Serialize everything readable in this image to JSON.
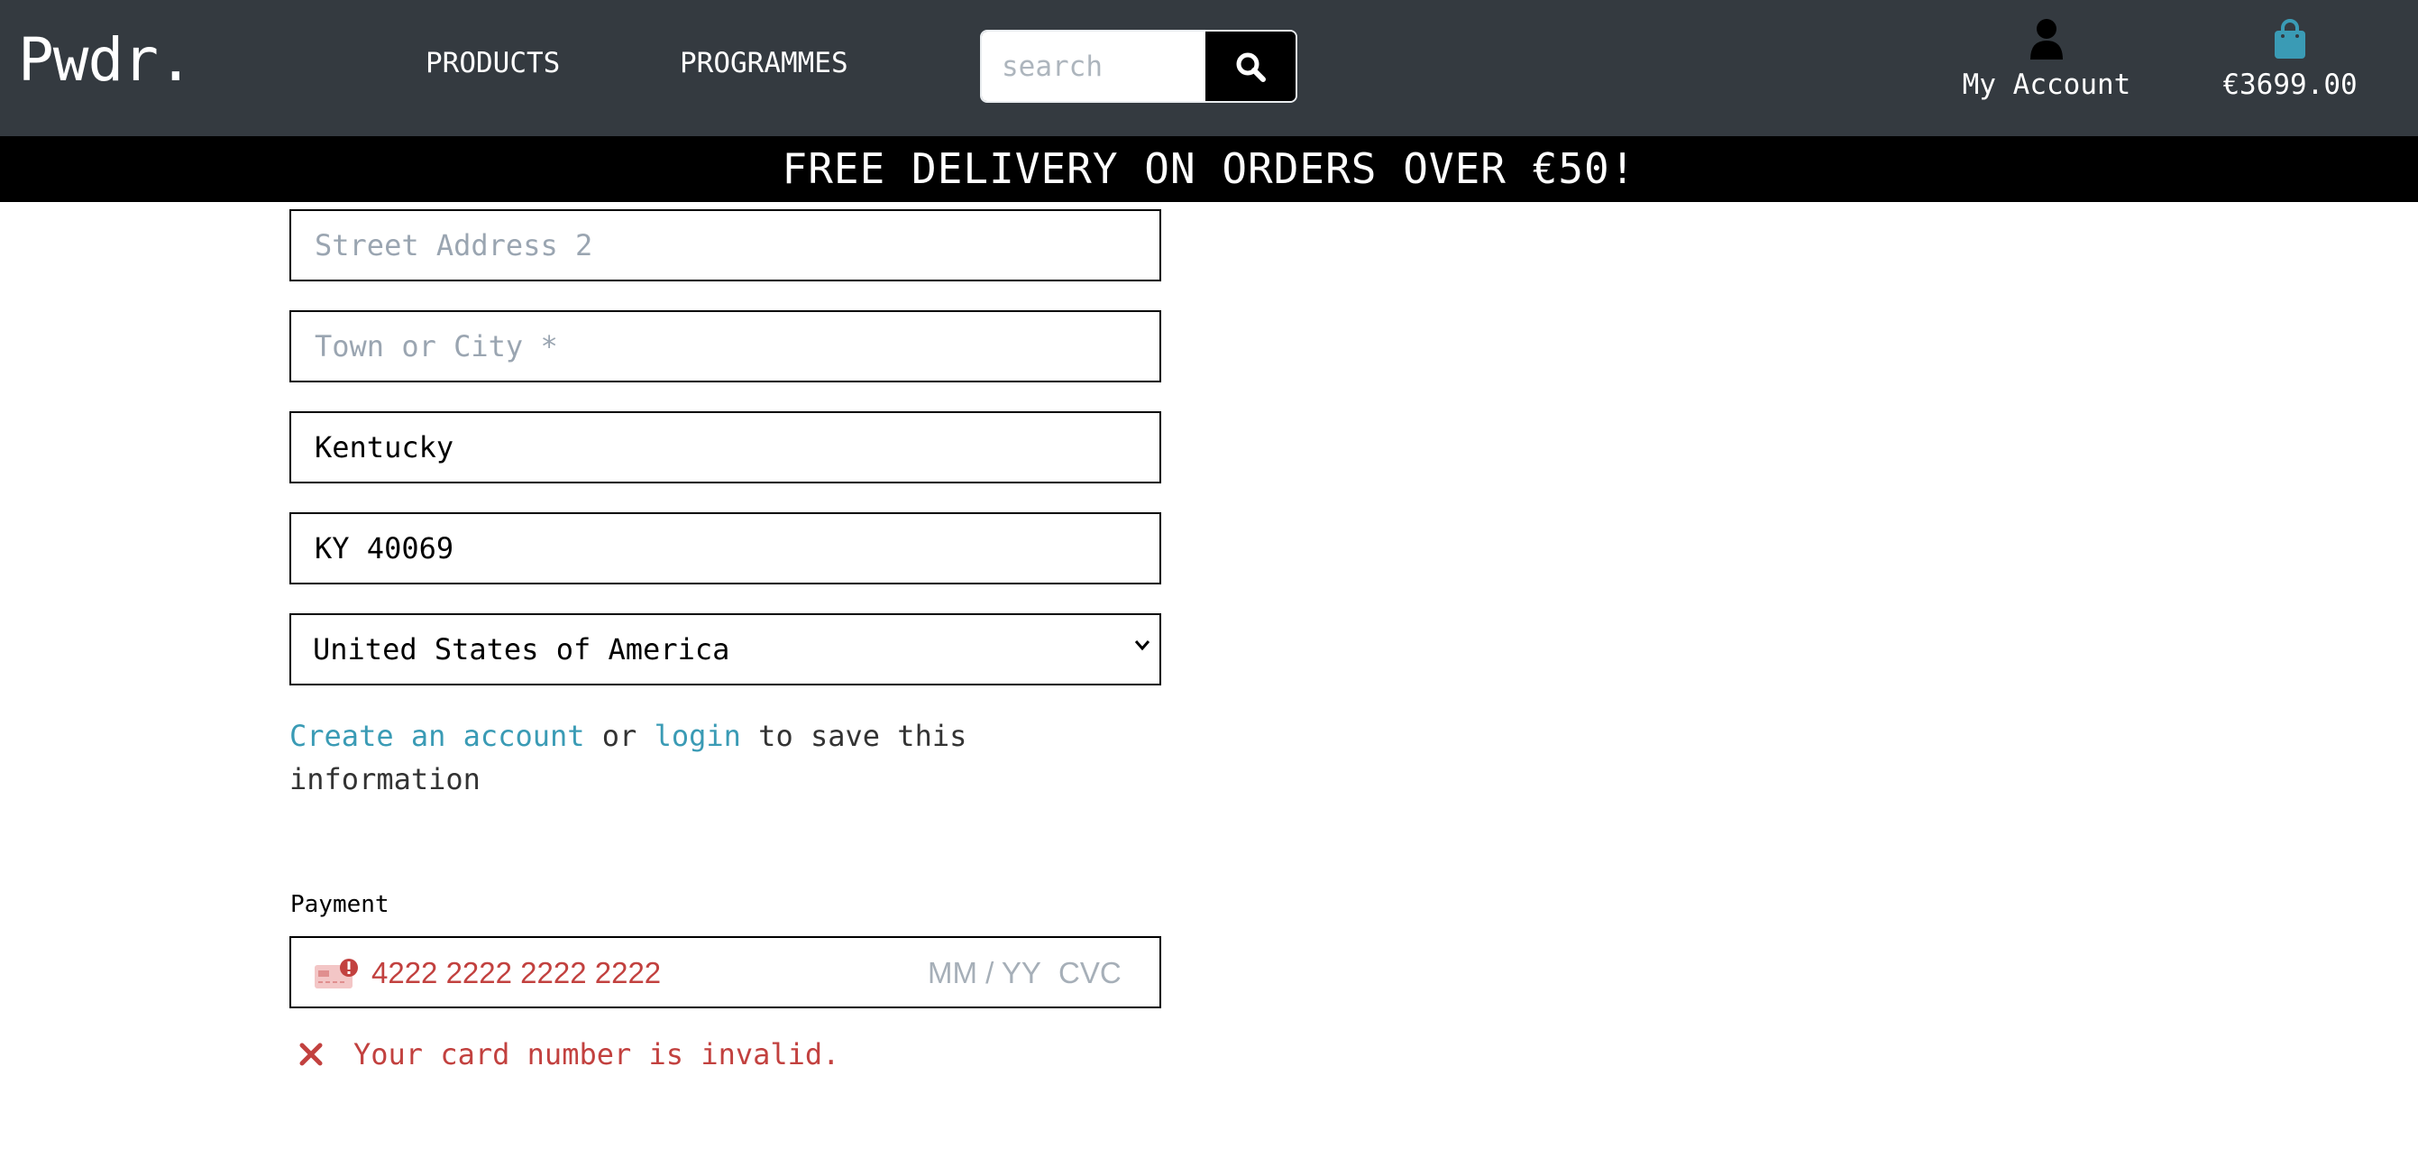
{
  "header": {
    "brand": "Pwdr.",
    "nav": [
      {
        "label": "PRODUCTS"
      },
      {
        "label": "PROGRAMMES"
      }
    ],
    "search": {
      "placeholder": "search",
      "icon": "search-icon"
    },
    "account": {
      "label": "My Account",
      "icon": "user-icon"
    },
    "bag": {
      "total": "€3699.00",
      "icon": "shopping-bag-icon"
    }
  },
  "banner": {
    "text": "FREE DELIVERY ON ORDERS OVER €50!"
  },
  "form": {
    "street_address_2": {
      "placeholder": "Street Address 2",
      "value": ""
    },
    "town_or_city": {
      "placeholder": "Town or City *",
      "value": ""
    },
    "county": {
      "value": "Kentucky"
    },
    "postcode": {
      "value": "KY 40069"
    },
    "country": {
      "selected": "United States of America"
    },
    "save_info": {
      "create_account_link": "Create an account",
      "or_text": " or ",
      "login_link": "login",
      "rest_text": " to save this information"
    }
  },
  "payment": {
    "label": "Payment",
    "card_number": "4222 2222 2222 2222",
    "expiry_placeholder": "MM / YY",
    "cvc_placeholder": "CVC",
    "error": "Your card number is invalid."
  },
  "colors": {
    "topbar": "#343a40",
    "banner": "#000000",
    "link": "#3a9bb5",
    "error": "#c2413f",
    "bag_icon": "#3a9bb5"
  }
}
